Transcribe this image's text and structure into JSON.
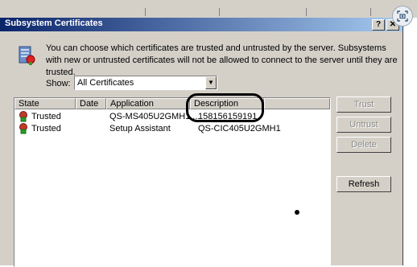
{
  "window": {
    "title": "Subsystem Certificates",
    "help_label": "?",
    "close_label": "✕"
  },
  "info": {
    "text": "You can choose which certificates are trusted and untrusted by the server. Subsystems with new or untrusted certificates will not be allowed to connect to the server until they are trusted."
  },
  "filter": {
    "label": "Show:",
    "selected": "All Certificates"
  },
  "table": {
    "columns": [
      "State",
      "Date",
      "Application",
      "Description"
    ],
    "rows": [
      {
        "state": "Trusted",
        "date": "",
        "application": "QS-MS405U2GMH1 ...",
        "description": "158156159191"
      },
      {
        "state": "Trusted",
        "date": "",
        "application": "Setup Assistant",
        "description": "QS-CIC405U2GMH1"
      }
    ]
  },
  "buttons": {
    "trust": "Trust",
    "untrust": "Untrust",
    "delete": "Delete",
    "refresh": "Refresh"
  },
  "colors": {
    "titlebar_start": "#0a246a",
    "titlebar_end": "#a6caf0",
    "dialog_bg": "#d4d0c8"
  }
}
